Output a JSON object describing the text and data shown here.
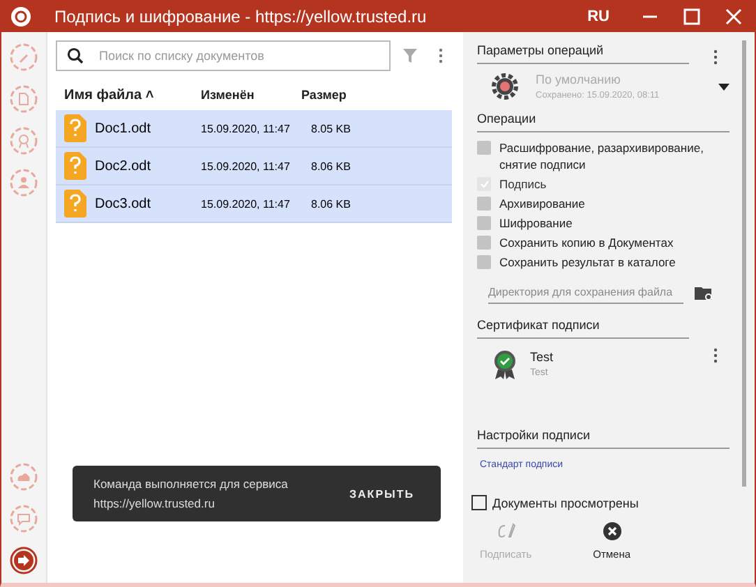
{
  "window": {
    "title": "Подпись и шифрование - https://yellow.trusted.ru",
    "language": "RU"
  },
  "sidebar": {
    "top_items": [
      {
        "kind": "pen",
        "selected": false
      },
      {
        "kind": "doc",
        "selected": false
      },
      {
        "kind": "cert",
        "selected": false
      },
      {
        "kind": "people",
        "selected": false
      }
    ],
    "bottom_items": [
      {
        "kind": "cloud",
        "selected": false
      },
      {
        "kind": "chat",
        "selected": false
      },
      {
        "kind": "exit",
        "selected": true
      }
    ]
  },
  "documents": {
    "search": {
      "placeholder": "Поиск по списку документов"
    },
    "columns": [
      "Имя файла ˄",
      "Изменён",
      "Размер"
    ],
    "rows": [
      {
        "name": "Doc1.odt",
        "modified": "15.09.2020, 11:47",
        "size": "8.05 KB",
        "selected": true
      },
      {
        "name": "Doc2.odt",
        "modified": "15.09.2020, 11:47",
        "size": "8.06 KB",
        "selected": true
      },
      {
        "name": "Doc3.odt",
        "modified": "15.09.2020, 11:47",
        "size": "8.06 KB",
        "selected": true
      }
    ]
  },
  "snackbar": {
    "message": "Команда выполняется для сервиса",
    "url": "https://yellow.trusted.ru",
    "action": "ЗАКРЫТЬ"
  },
  "settings": {
    "title": "Параметры операций",
    "profile": {
      "name": "По умолчанию",
      "saved": "Сохранено: 15.09.2020, 08:11"
    },
    "operations_title": "Операции",
    "operations": [
      {
        "label": "Расшифрование, разархивирование, снятие подписи",
        "checked": false,
        "disabled": false
      },
      {
        "label": "Подпись",
        "checked": true,
        "disabled": true
      },
      {
        "label": "Архивирование",
        "checked": false,
        "disabled": false
      },
      {
        "label": "Шифрование",
        "checked": false,
        "disabled": false
      },
      {
        "label": "Сохранить копию в Документах",
        "checked": false,
        "disabled": false
      },
      {
        "label": "Сохранить результат в каталоге",
        "checked": false,
        "disabled": false
      }
    ],
    "directory": {
      "placeholder": "Директория для сохранения файла"
    },
    "certificate_title": "Сертификат подписи",
    "certificate": {
      "name": "Test",
      "issuer": "Test"
    },
    "signature_title": "Настройки подписи",
    "signature_link": "Стандарт подписи",
    "reviewed": {
      "label": "Документы просмотрены",
      "checked": false
    },
    "actions": [
      {
        "kind": "sign",
        "label": "Подписать",
        "disabled": true
      },
      {
        "kind": "cancel",
        "label": "Отмена",
        "disabled": false
      }
    ]
  }
}
